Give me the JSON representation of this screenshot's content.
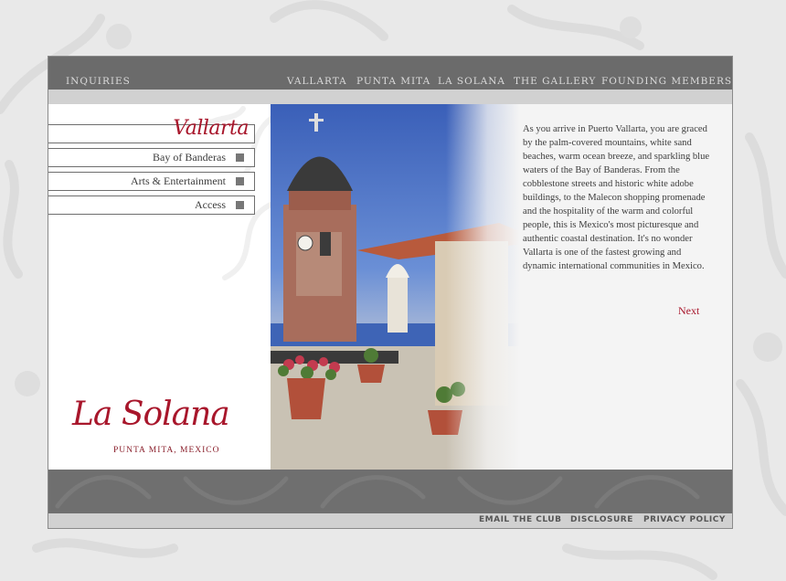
{
  "nav": {
    "inquiries": "INQUIRIES",
    "vallarta": "VALLARTA",
    "punta_mita": "PUNTA MITA",
    "la_solana": "LA SOLANA",
    "gallery": "THE GALLERY",
    "founding": "FOUNDING MEMBERS"
  },
  "section": {
    "title": "Vallarta",
    "menu": [
      {
        "label": "Bay of Banderas"
      },
      {
        "label": "Arts & Entertainment"
      },
      {
        "label": "Access"
      }
    ]
  },
  "logo": {
    "name": "La Solana",
    "location": "PUNTA MITA, MEXICO"
  },
  "content": {
    "body": "As you arrive in Puerto Vallarta, you are graced by the palm-covered mountains, white sand beaches, warm ocean breeze, and sparkling blue waters of the Bay of Banderas. From the cobblestone streets and historic white adobe buildings, to the Malecon shopping promenade and the hospitality of the warm and colorful people, this is Mexico's most picturesque and authentic coastal destination. It's no wonder Vallarta is one of the fastest growing and dynamic international communities in Mexico.",
    "next": "Next"
  },
  "footer": {
    "email": "EMAIL THE CLUB",
    "disclosure": "DISCLOSURE",
    "privacy": "PRIVACY POLICY"
  },
  "colors": {
    "accent": "#a8162b",
    "topbar": "#6b6b6b",
    "subbar": "#d1d1d1",
    "page_bg": "#e9e9e9"
  }
}
